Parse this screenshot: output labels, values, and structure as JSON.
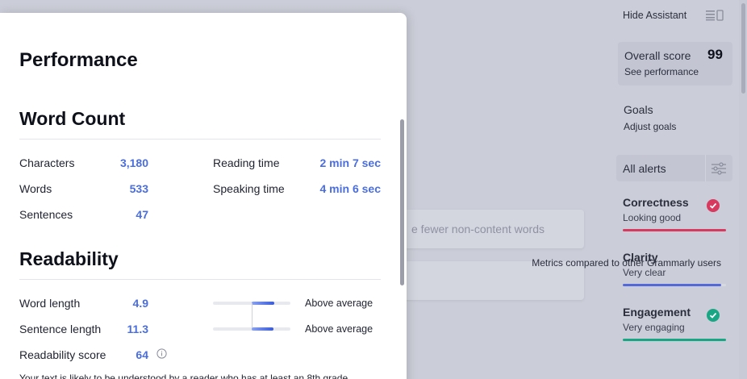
{
  "background": {
    "card1_text": "e fewer non-content words"
  },
  "sidebar": {
    "hide_assistant": "Hide Assistant",
    "overall_score_label": "Overall score",
    "overall_score_value": "99",
    "see_performance": "See performance",
    "goals_title": "Goals",
    "goals_sub": "Adjust goals",
    "all_alerts": "All alerts",
    "metrics": [
      {
        "title": "Correctness",
        "status": "Looking good",
        "color": "#d8395e",
        "check": true,
        "fill": 1.0
      },
      {
        "title": "Clarity",
        "status": "Very clear",
        "color": "#5468d8",
        "check": false,
        "fill": 0.95
      },
      {
        "title": "Engagement",
        "status": "Very engaging",
        "color": "#18a684",
        "check": true,
        "fill": 1.0
      }
    ]
  },
  "panel": {
    "title": "Performance",
    "word_count": {
      "heading": "Word Count",
      "characters_label": "Characters",
      "characters_value": "3,180",
      "words_label": "Words",
      "words_value": "533",
      "sentences_label": "Sentences",
      "sentences_value": "47",
      "reading_time_label": "Reading time",
      "reading_time_value": "2 min 7 sec",
      "speaking_time_label": "Speaking time",
      "speaking_time_value": "4 min 6 sec"
    },
    "readability": {
      "heading": "Readability",
      "note": "Metrics compared to other Grammarly users",
      "word_length_label": "Word length",
      "word_length_value": "4.9",
      "word_length_compare": "Above average",
      "sentence_length_label": "Sentence length",
      "sentence_length_value": "11.3",
      "sentence_length_compare": "Above average",
      "readability_score_label": "Readability score",
      "readability_score_value": "64",
      "cutoff_text": "Your text is likely to be understood by a reader who has at least an 8th grade"
    }
  },
  "colors": {
    "accent_blue": "#4a6ee0",
    "correctness": "#d8395e",
    "clarity": "#5468d8",
    "engagement": "#18a684"
  }
}
